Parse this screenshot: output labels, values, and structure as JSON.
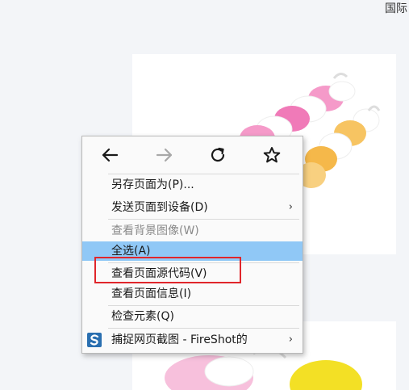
{
  "page": {
    "top_right_text": "国际"
  },
  "context_menu": {
    "nav": {
      "back_icon": "arrow-left-icon",
      "forward_icon": "arrow-right-icon",
      "reload_icon": "reload-icon",
      "bookmark_icon": "star-icon"
    },
    "items": [
      {
        "label": "另存页面为(P)...",
        "state": "normal"
      },
      {
        "label": "发送页面到设备(D)",
        "state": "normal",
        "submenu": true
      },
      {
        "label": "查看背景图像(W)",
        "state": "disabled"
      },
      {
        "label": "全选(A)",
        "state": "highlighted"
      },
      {
        "label": "查看页面源代码(V)",
        "state": "normal"
      },
      {
        "label": "查看页面信息(I)",
        "state": "normal"
      },
      {
        "label": "检查元素(Q)",
        "state": "normal"
      },
      {
        "label": "捕捉网页截图 - FireShot的",
        "state": "normal",
        "submenu": true,
        "icon": "fireshot-icon"
      }
    ],
    "submenu_arrow": "›"
  },
  "colors": {
    "highlight": "#90c8f6",
    "annotation_box": "#e0262b"
  }
}
